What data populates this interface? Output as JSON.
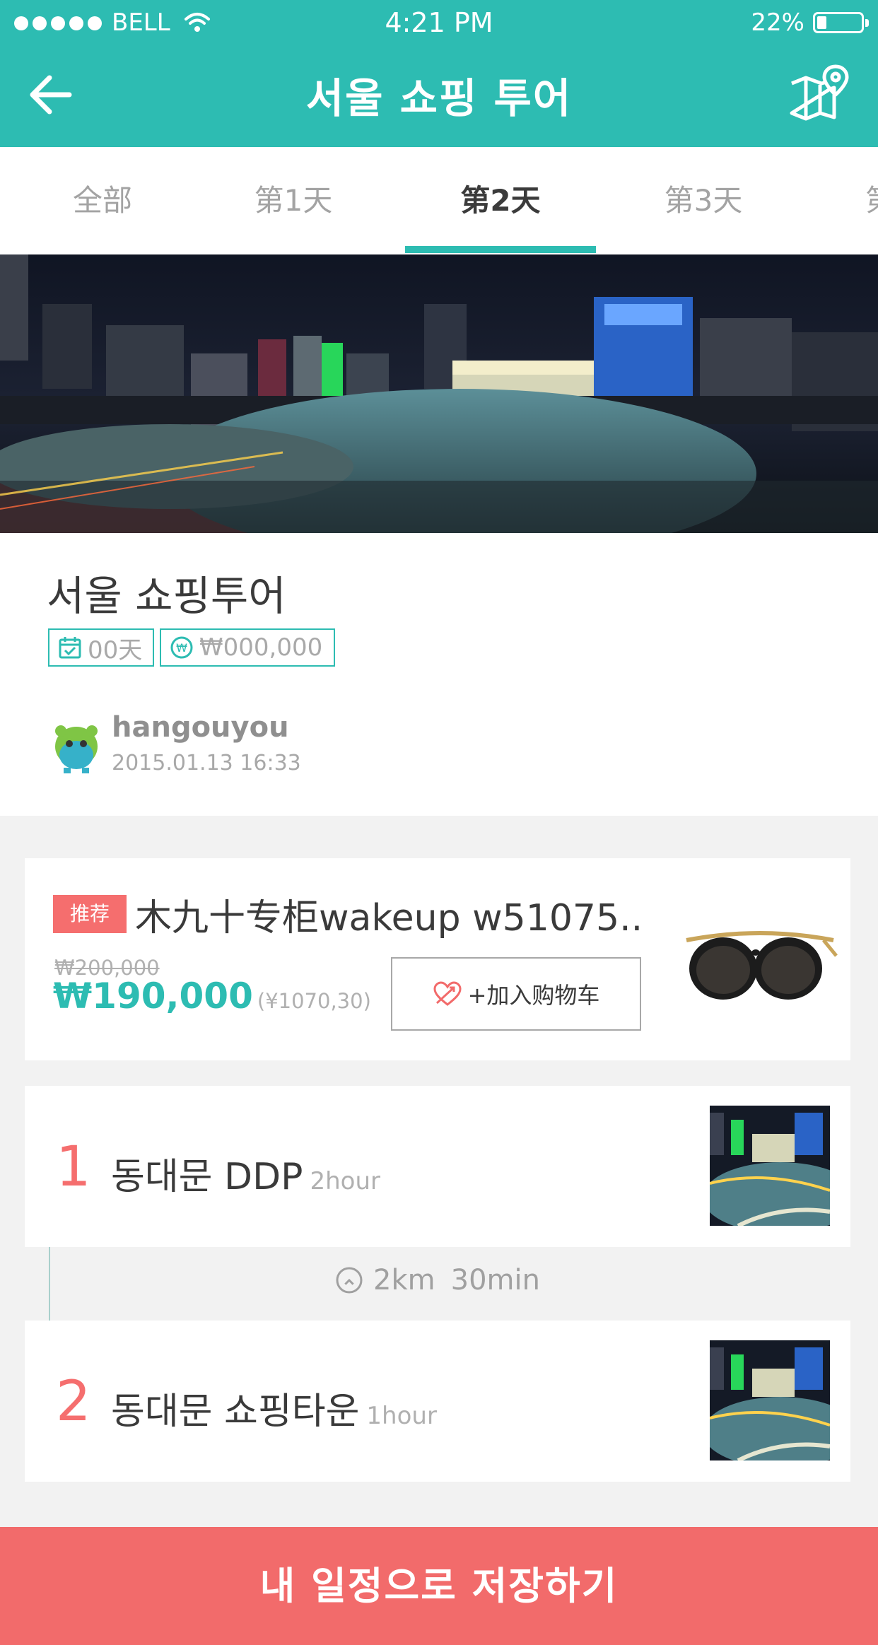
{
  "status_bar": {
    "carrier": "BELL",
    "time": "4:21 PM",
    "battery": "22%",
    "battery_level": 0.22
  },
  "header": {
    "title": "서울 쇼핑 투어",
    "back_icon": "arrow-left-icon",
    "map_icon": "map-pin-icon"
  },
  "tabs": [
    {
      "label": "全部",
      "active": false
    },
    {
      "label": "第1天",
      "active": false
    },
    {
      "label": "第2天",
      "active": true
    },
    {
      "label": "第3天",
      "active": false
    },
    {
      "label": "第",
      "active": false
    }
  ],
  "plan": {
    "title": "서울 쇼핑투어",
    "days": "00天",
    "budget": "₩000,000",
    "author": "hangouyou",
    "date": "2015.01.13  16:33"
  },
  "product": {
    "badge": "推荐",
    "title": "木九十专柜wakeup w51075..",
    "old_price": "₩200,000",
    "price": "₩190,000",
    "price_cny": "(¥1070,30)",
    "cart_label": "+加入购物车"
  },
  "spots": [
    {
      "num": "1",
      "name": "동대문 DDP",
      "duration": "2hour"
    },
    {
      "num": "2",
      "name": "동대문 쇼핑타운",
      "duration": "1hour"
    }
  ],
  "route": {
    "distance": "2km",
    "time": "30min"
  },
  "save_label": "내 일정으로 저장하기",
  "colors": {
    "primary": "#2dbcb2",
    "accent": "#f26b6b",
    "background": "#f2f2f2"
  }
}
